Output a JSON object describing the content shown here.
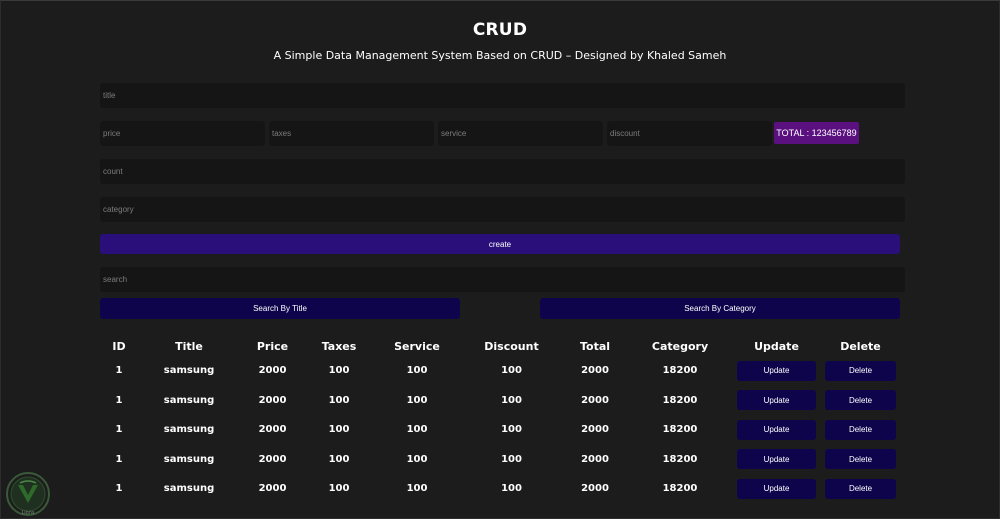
{
  "header": {
    "title": "CRUD",
    "subtitle": "A Simple Data Management System Based on CRUD – Designed by Khaled Sameh"
  },
  "form": {
    "title_placeholder": "title",
    "price_placeholder": "price",
    "taxes_placeholder": "taxes",
    "service_placeholder": "service",
    "discount_placeholder": "discount",
    "total_label": "TOTAL : 123456789",
    "count_placeholder": "count",
    "category_placeholder": "category",
    "create_label": "create"
  },
  "search": {
    "placeholder": "search",
    "by_title_label": "Search By Title",
    "by_category_label": "Search By Category"
  },
  "table": {
    "headers": [
      "ID",
      "Title",
      "Price",
      "Taxes",
      "Service",
      "Discount",
      "Total",
      "Category",
      "Update",
      "Delete"
    ],
    "update_label": "Update",
    "delete_label": "Delete",
    "rows": [
      [
        "1",
        "samsung",
        "2000",
        "100",
        "100",
        "100",
        "2000",
        "18200"
      ],
      [
        "1",
        "samsung",
        "2000",
        "100",
        "100",
        "100",
        "2000",
        "18200"
      ],
      [
        "1",
        "samsung",
        "2000",
        "100",
        "100",
        "100",
        "2000",
        "18200"
      ],
      [
        "1",
        "samsung",
        "2000",
        "100",
        "100",
        "100",
        "2000",
        "18200"
      ],
      [
        "1",
        "samsung",
        "2000",
        "100",
        "100",
        "100",
        "2000",
        "18200"
      ]
    ]
  },
  "logo": {
    "text": "Lions"
  },
  "colors": {
    "background": "#1c1c1c",
    "input_background": "#151515",
    "total_badge": "#5b1080",
    "create_button": "#2a0f7a",
    "action_button": "#0d044b",
    "logo_green": "#2e6b2b"
  }
}
